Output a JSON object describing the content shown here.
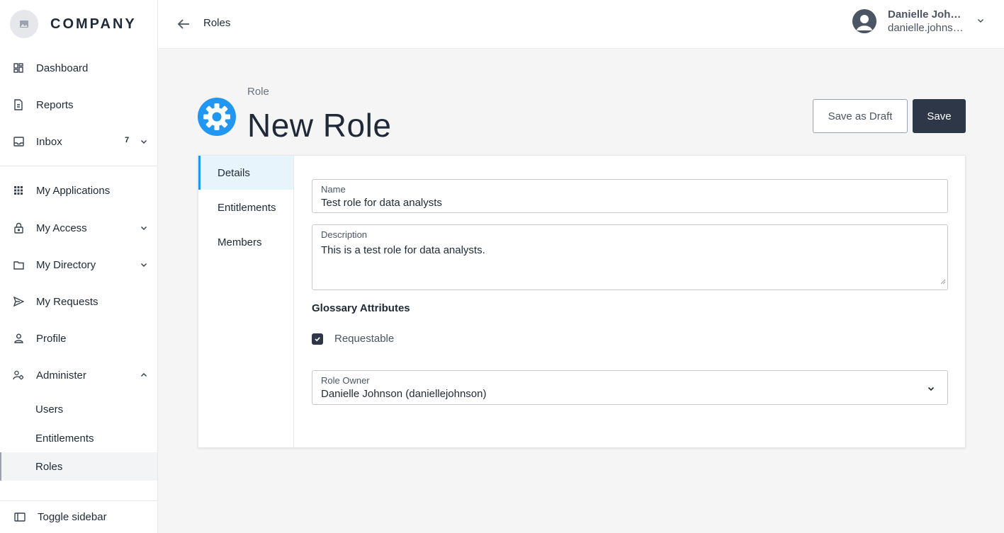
{
  "brand": {
    "name": "COMPANY"
  },
  "sidebar": {
    "items": [
      {
        "label": "Dashboard"
      },
      {
        "label": "Reports"
      },
      {
        "label": "Inbox",
        "badge": "7"
      },
      {
        "label": "My Applications"
      },
      {
        "label": "My Access"
      },
      {
        "label": "My Directory"
      },
      {
        "label": "My Requests"
      },
      {
        "label": "Profile"
      },
      {
        "label": "Administer"
      }
    ],
    "sub_items": [
      {
        "label": "Users"
      },
      {
        "label": "Entitlements"
      },
      {
        "label": "Roles"
      }
    ],
    "toggle_label": "Toggle sidebar"
  },
  "topbar": {
    "breadcrumb": "Roles",
    "user_name": "Danielle Johnson",
    "user_email": "danielle.johnson@example.com"
  },
  "header": {
    "eyebrow": "Role",
    "title": "New Role",
    "draft_label": "Save as Draft",
    "save_label": "Save"
  },
  "tabs": [
    {
      "label": "Details"
    },
    {
      "label": "Entitlements"
    },
    {
      "label": "Members"
    }
  ],
  "form": {
    "name_label": "Name",
    "name_value": "Test role for data analysts",
    "description_label": "Description",
    "description_value": "This is a test role for data analysts.",
    "section_title": "Glossary Attributes",
    "requestable_label": "Requestable",
    "requestable_checked": true,
    "owner_label": "Role Owner",
    "owner_value": "Danielle Johnson (daniellejohnson)"
  },
  "colors": {
    "accent": "#2196f3",
    "primary_button": "#2d3748",
    "active_tab_bg": "#e8f4fc"
  }
}
